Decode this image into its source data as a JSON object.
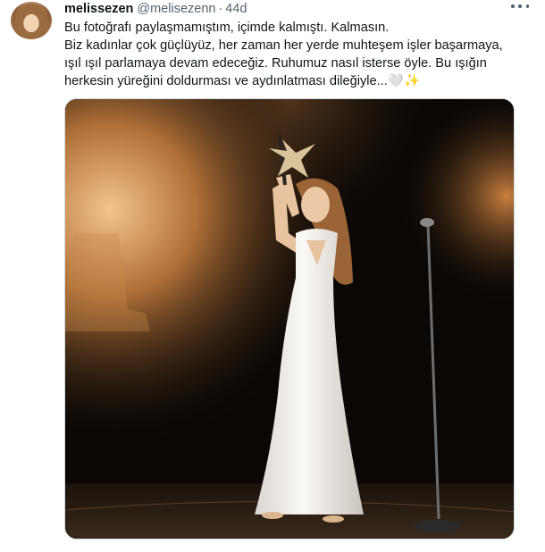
{
  "tweet": {
    "display_name": "melissezen",
    "handle": "@melisezenn",
    "separator": "·",
    "time": "44d",
    "text_lines": [
      "Bu fotoğrafı paylaşmamıştım, içimde kalmıştı. Kalmasın.",
      "Biz kadınlar çok güçlüyüz, her zaman her yerde muhteşem işler başarmaya,",
      "ışıl ışıl parlamaya devam edeceğiz. Ruhumuz nasıl isterse öyle. Bu ışığın",
      "herkesin yüreğini doldurması ve aydınlatması dileğiyle..."
    ],
    "emoji_heart": "🤍",
    "emoji_sparkle": "✨",
    "more_icon": "more-horizontal-icon",
    "avatar_icon": "avatar",
    "media": {
      "icon": "photo",
      "colors": {
        "backdrop": "#0a0705",
        "glow": "#c98a4a",
        "dress": "#f4f1ec",
        "hair": "#9a6436",
        "skin": "#e8c3a0"
      }
    }
  }
}
